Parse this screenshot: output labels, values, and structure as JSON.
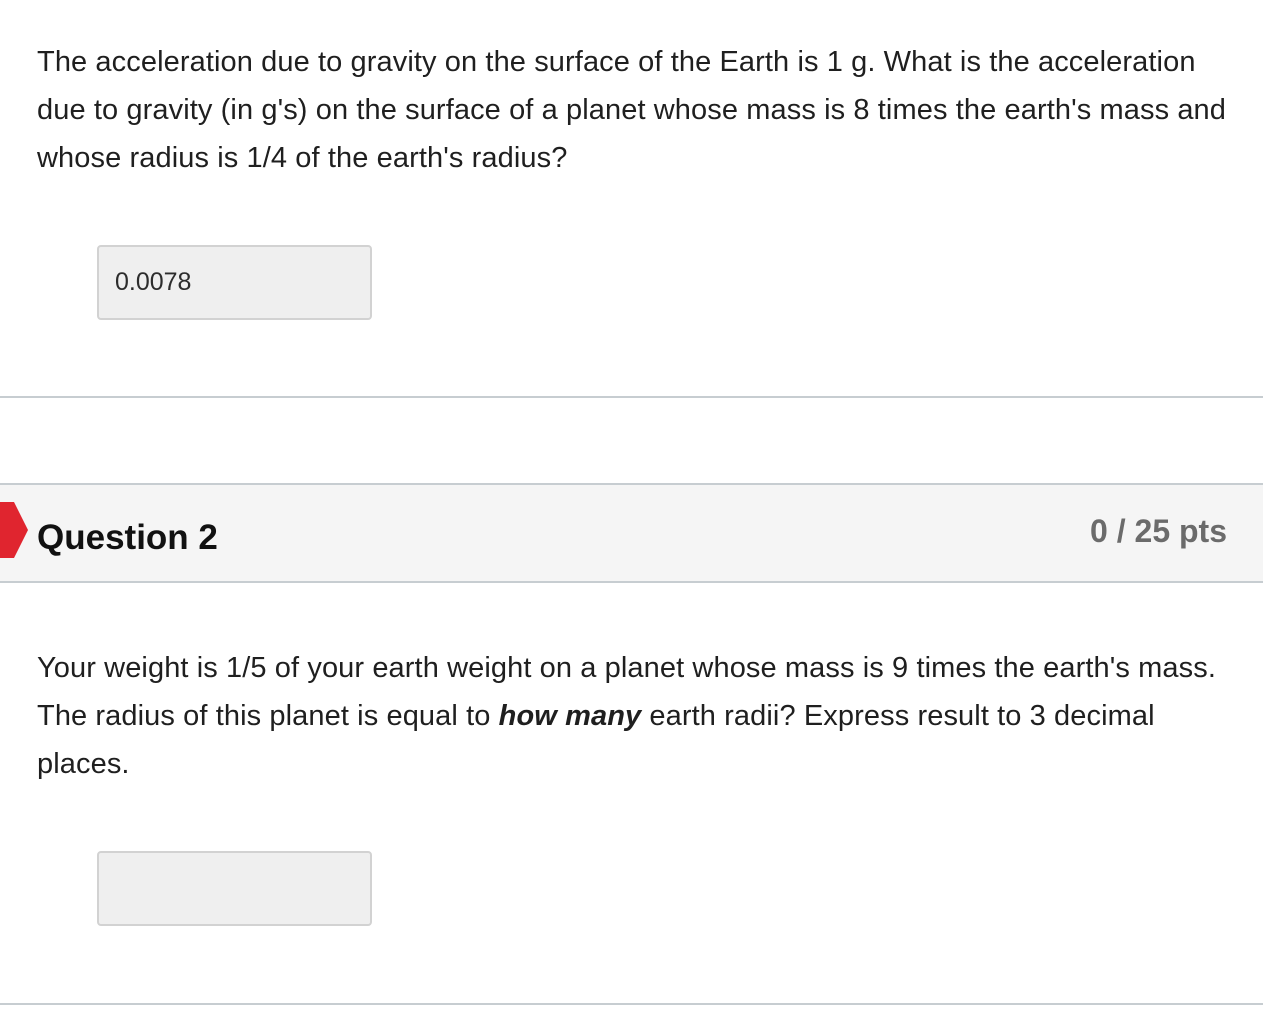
{
  "question1": {
    "text": "The acceleration due to gravity on the surface of the Earth is 1 g.  What is the acceleration due to gravity (in g's) on the surface of a planet whose mass is 8 times the earth's mass and whose radius is 1/4 of the earth's radius?",
    "answer_value": "0.0078"
  },
  "question2": {
    "title": "Question 2",
    "points": "0 / 25 pts",
    "flag_icon": "incorrect-flag-icon",
    "flag_color": "#e0252f",
    "text_before": "Your weight is 1/5 of your earth weight on a planet whose mass is 9 times the earth's mass. The radius of this planet is equal to ",
    "text_emphasis": "how many",
    "text_after": " earth radii?  Express result to 3 decimal places.",
    "answer_value": ""
  }
}
